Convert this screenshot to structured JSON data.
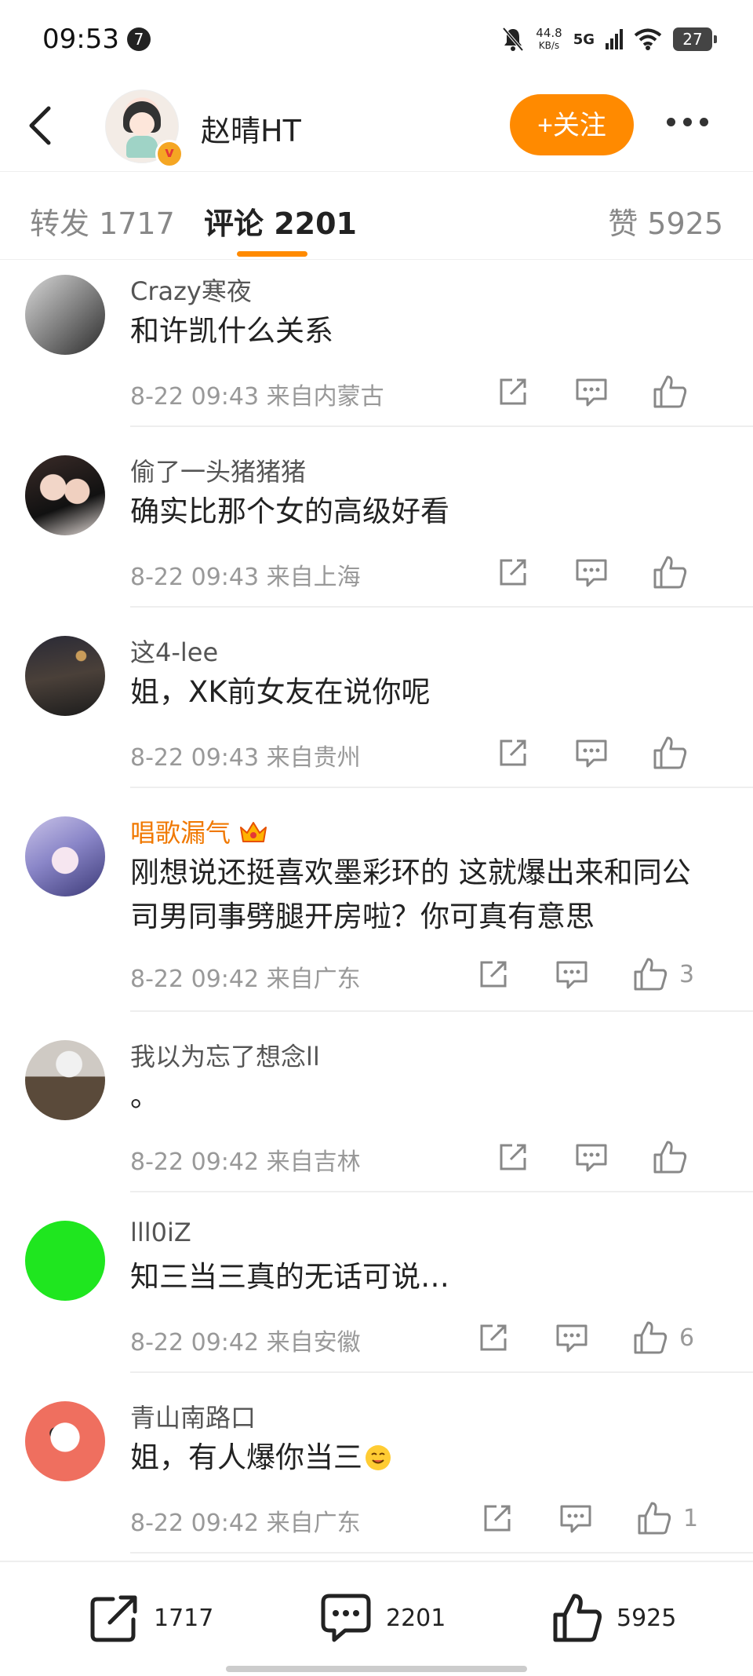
{
  "status_bar": {
    "time": "09:53",
    "notification_count": "7",
    "speed_value": "44.8",
    "speed_unit": "KB/s",
    "network": "5G",
    "battery": "27"
  },
  "header": {
    "username": "赵晴HT",
    "follow_label": "+关注",
    "verified_mark": "v"
  },
  "tabs": {
    "repost": "转发 1717",
    "comment": "评论 2201",
    "like": "赞 5925"
  },
  "comments": [
    {
      "name": "Crazy寒夜",
      "text": "和许凯什么关系",
      "meta": "8-22 09:43  来自内蒙古",
      "likes": ""
    },
    {
      "name": "偷了一头猪猪猪",
      "text": "确实比那个女的高级好看",
      "meta": "8-22 09:43  来自上海",
      "likes": ""
    },
    {
      "name": "这4-lee",
      "text": "姐，XK前女友在说你呢",
      "meta": "8-22 09:43  来自贵州",
      "likes": ""
    },
    {
      "name": "唱歌漏气",
      "text": "刚想说还挺喜欢墨彩环的 这就爆出来和同公司男同事劈腿开房啦？你可真有意思",
      "meta": "8-22 09:42  来自广东",
      "likes": "3"
    },
    {
      "name": "我以为忘了想念ll",
      "text": "。",
      "meta": "8-22 09:42  来自吉林",
      "likes": ""
    },
    {
      "name": "lll0iZ",
      "text": "知三当三真的无话可说…",
      "meta": "8-22 09:42  来自安徽",
      "likes": "6"
    },
    {
      "name": "青山南路口",
      "text": "姐，有人爆你当三",
      "meta": "8-22 09:42  来自广东",
      "likes": "1"
    }
  ],
  "bottom_bar": {
    "repost_count": "1717",
    "comment_count": "2201",
    "like_count": "5925"
  },
  "colors": {
    "accent": "#ff8a00",
    "vip_name": "#f07800",
    "meta_text": "#999999"
  }
}
